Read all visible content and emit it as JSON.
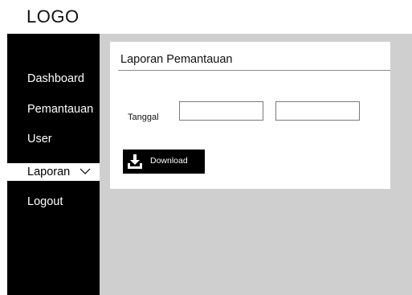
{
  "header": {
    "logo_text": "LOGO"
  },
  "sidebar": {
    "items": [
      {
        "label": "Dashboard"
      },
      {
        "label": "Pemantauan"
      },
      {
        "label": "User"
      },
      {
        "label": "Laporan",
        "active": true,
        "icon": "chevron-down-icon"
      },
      {
        "label": "Logout"
      }
    ]
  },
  "main": {
    "card": {
      "title": "Laporan Pemantauan",
      "date_label": "Tanggal",
      "date_from_value": "",
      "date_to_value": "",
      "download_label": "Download",
      "download_icon": "download-icon"
    }
  },
  "colors": {
    "sidebar_bg": "#000000",
    "content_bg": "#cfcfcf",
    "card_bg": "#ffffff",
    "button_bg": "#000000"
  }
}
